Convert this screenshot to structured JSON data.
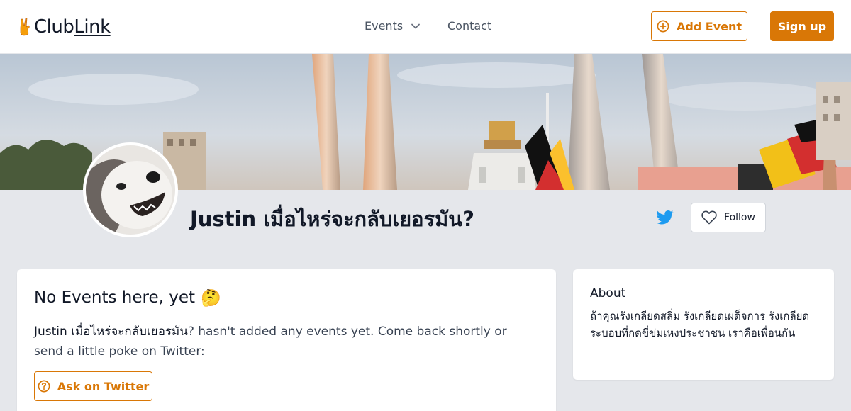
{
  "header": {
    "logo": {
      "text_club": "Club",
      "text_link": "Link",
      "icon": "victory-hand-icon"
    },
    "nav": {
      "events_label": "Events",
      "contact_label": "Contact"
    },
    "add_event_label": "Add Event",
    "signup_label": "Sign up"
  },
  "profile": {
    "name": "Justin เมื่อไหร่จะกลับเยอรมัน?",
    "follow_label": "Follow",
    "twitter_icon": "twitter-icon"
  },
  "events_card": {
    "title": "No Events here, yet",
    "emoji": "🤔",
    "text_name": "Justin เมื่อไหร่จะกลับเยอรมัน",
    "text_rest": "? hasn't added any events yet. Come back shortly or send a little poke on Twitter:",
    "ask_label": "Ask on Twitter"
  },
  "about_card": {
    "title": "About",
    "text": "ถ้าคุณรังเกลียดสลิ่ม รังเกลียดเผด็จการ รังเกลียดระบอบที่กดขี่ข่มเหงประชาชน เราคือเพื่อนกัน"
  },
  "colors": {
    "accent": "#d97706",
    "twitter": "#1d9bf0",
    "page_bg": "#e5e7eb"
  }
}
